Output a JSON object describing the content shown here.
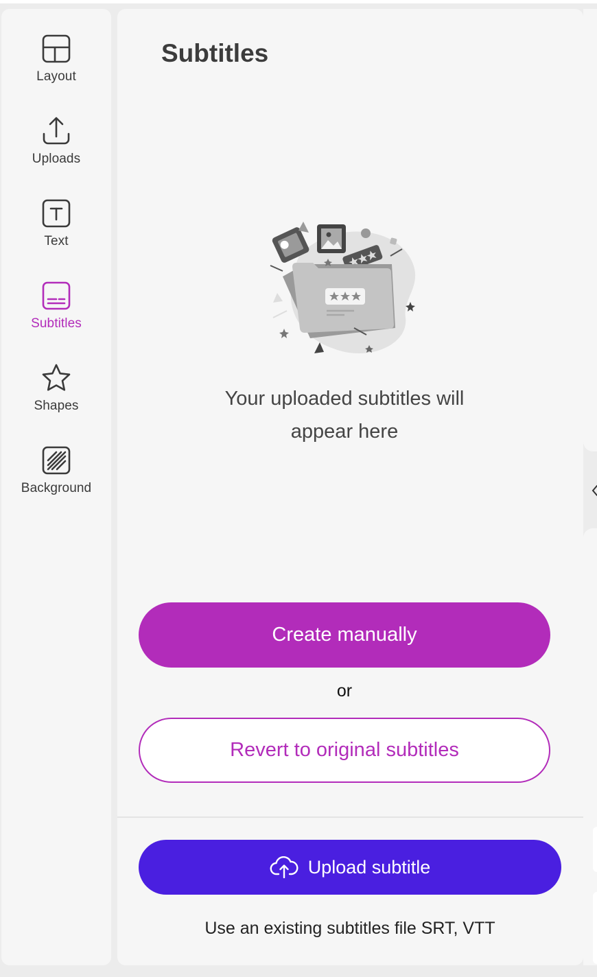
{
  "sidebar": {
    "items": [
      {
        "label": "Layout",
        "icon": "layout-icon"
      },
      {
        "label": "Uploads",
        "icon": "upload-icon"
      },
      {
        "label": "Text",
        "icon": "text-icon"
      },
      {
        "label": "Subtitles",
        "icon": "subtitles-icon",
        "active": true
      },
      {
        "label": "Shapes",
        "icon": "star-icon"
      },
      {
        "label": "Background",
        "icon": "background-icon"
      }
    ]
  },
  "panel": {
    "title": "Subtitles",
    "empty_message": "Your uploaded subtitles will appear here",
    "create_label": "Create manually",
    "or_label": "or",
    "revert_label": "Revert to original subtitles",
    "upload_label": "Upload subtitle",
    "upload_hint": "Use an existing subtitles file SRT, VTT"
  },
  "colors": {
    "accent": "#b22cba",
    "upload_button": "#4a1fe0",
    "panel_bg": "#f6f6f6",
    "page_bg": "#ececec"
  }
}
